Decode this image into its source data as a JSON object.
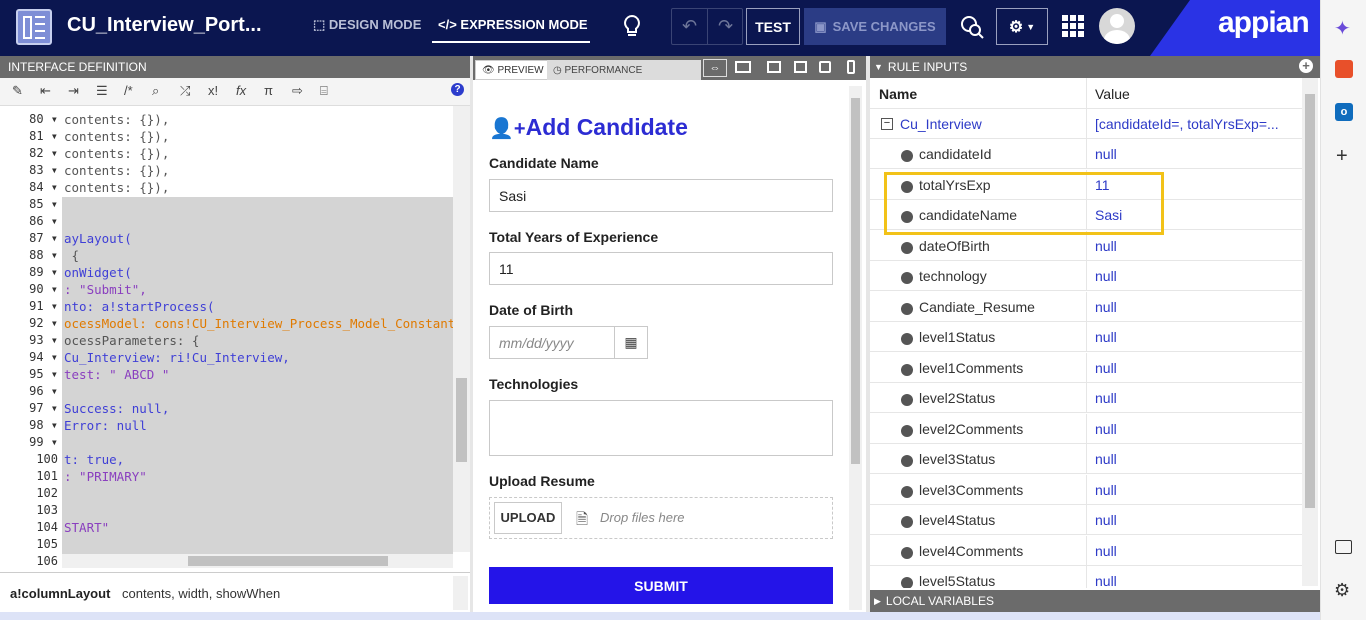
{
  "header": {
    "title": "CU_Interview_Port...",
    "design_mode": "DESIGN MODE",
    "expression_mode": "EXPRESSION MODE",
    "test": "TEST",
    "save": "SAVE CHANGES",
    "brand": "appian"
  },
  "left_panel": {
    "title": "INTERFACE DEFINITION",
    "line_numbers": [
      "80",
      "81",
      "82",
      "83",
      "84",
      "85",
      "86",
      "87",
      "88",
      "89",
      "90",
      "91",
      "92",
      "93",
      "94",
      "95",
      "96",
      "97",
      "98",
      "99",
      "100",
      "101",
      "102",
      "103",
      "104",
      "105",
      "106"
    ],
    "code": [
      {
        "t": "contents: {}),",
        "c": "g"
      },
      {
        "t": "contents: {}),",
        "c": "g"
      },
      {
        "t": "contents: {}),",
        "c": "g"
      },
      {
        "t": "contents: {}),",
        "c": "g"
      },
      {
        "t": "contents: {}),",
        "c": "g"
      },
      {
        "t": "",
        "c": "g"
      },
      {
        "t": "",
        "c": "g"
      },
      {
        "t": "ayLayout(",
        "c": "k"
      },
      {
        "t": " {",
        "c": "g"
      },
      {
        "t": "onWidget(",
        "c": "k"
      },
      {
        "t": ": \"Submit\",",
        "c": "s"
      },
      {
        "t": "nto: a!startProcess(",
        "c": "k"
      },
      {
        "t": "ocessModel: cons!CU_Interview_Process_Model_Constant,",
        "c": "o"
      },
      {
        "t": "ocessParameters: {",
        "c": "g"
      },
      {
        "t": "Cu_Interview: ri!Cu_Interview,",
        "c": "k"
      },
      {
        "t": "test: \" ABCD \"",
        "c": "s"
      },
      {
        "t": "",
        "c": "g"
      },
      {
        "t": "Success: null,",
        "c": "k"
      },
      {
        "t": "Error: null",
        "c": "k"
      },
      {
        "t": "",
        "c": "g"
      },
      {
        "t": "t: true,",
        "c": "k"
      },
      {
        "t": ": \"PRIMARY\"",
        "c": "s"
      },
      {
        "t": "",
        "c": "g"
      },
      {
        "t": "",
        "c": "g"
      },
      {
        "t": "START\"",
        "c": "s"
      },
      {
        "t": "",
        "c": "g"
      },
      {
        "t": "",
        "c": "g"
      }
    ],
    "footer_fn": "a!columnLayout",
    "footer_params": "contents, width, showWhen"
  },
  "preview": {
    "tab_preview": "PREVIEW",
    "tab_performance": "PERFORMANCE",
    "form_title": "Add Candidate",
    "name_label": "Candidate Name",
    "name_value": "Sasi",
    "exp_label": "Total Years of Experience",
    "exp_value": "11",
    "dob_label": "Date of Birth",
    "dob_placeholder": "mm/dd/yyyy",
    "tech_label": "Technologies",
    "upload_label": "Upload Resume",
    "upload_btn": "UPLOAD",
    "drop_text": "Drop files here",
    "submit": "SUBMIT"
  },
  "rule_inputs": {
    "title": "RULE INPUTS",
    "col_name": "Name",
    "col_value": "Value",
    "root_name": "Cu_Interview",
    "root_value": "[candidateId=, totalYrsExp=...",
    "rows": [
      {
        "name": "candidateId",
        "value": "null"
      },
      {
        "name": "totalYrsExp",
        "value": "11"
      },
      {
        "name": "candidateName",
        "value": "Sasi"
      },
      {
        "name": "dateOfBirth",
        "value": "null"
      },
      {
        "name": "technology",
        "value": "null"
      },
      {
        "name": "Candiate_Resume",
        "value": "null"
      },
      {
        "name": "level1Status",
        "value": "null"
      },
      {
        "name": "level1Comments",
        "value": "null"
      },
      {
        "name": "level2Status",
        "value": "null"
      },
      {
        "name": "level2Comments",
        "value": "null"
      },
      {
        "name": "level3Status",
        "value": "null"
      },
      {
        "name": "level3Comments",
        "value": "null"
      },
      {
        "name": "level4Status",
        "value": "null"
      },
      {
        "name": "level4Comments",
        "value": "null"
      },
      {
        "name": "level5Status",
        "value": "null"
      }
    ],
    "local_vars": "LOCAL VARIABLES",
    "highlight_color": "#f2c218"
  }
}
